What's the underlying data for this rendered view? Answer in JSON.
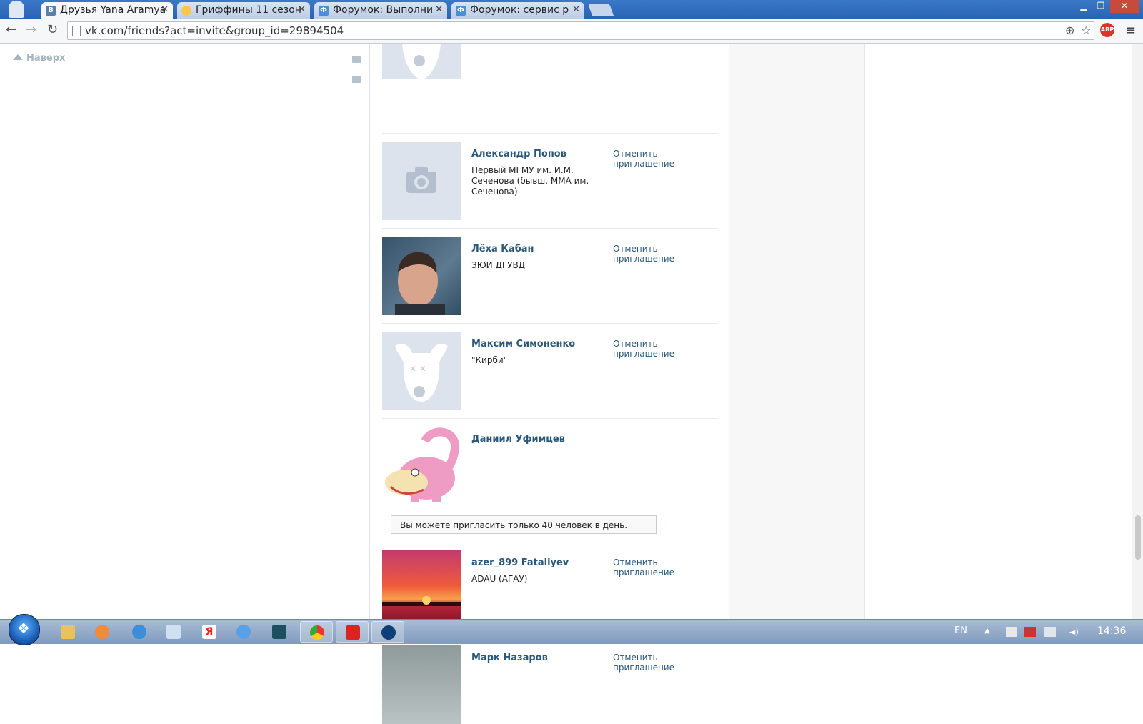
{
  "browser": {
    "tabs": [
      {
        "title": "Друзья Yana Aramya",
        "icon": "vk-icon",
        "active": true
      },
      {
        "title": "Гриффины 11 сезон",
        "icon": "multiplex-icon",
        "active": false
      },
      {
        "title": "Форумок: Выполни",
        "icon": "forum-icon",
        "active": false
      },
      {
        "title": "Форумок: сервис р",
        "icon": "forum-icon",
        "active": false
      }
    ],
    "url": "vk.com/friends?act=invite&group_id=29894504",
    "abp_label": "ABP"
  },
  "page": {
    "top_link": "Наверх",
    "invites": [
      {
        "name": "",
        "description": "",
        "cancel_label": "",
        "avatar": "dog-placeholder"
      },
      {
        "name": "Александр Попов",
        "description": "Первый МГМУ им. И.М. Сеченова (бывш. ММА им. Сеченова)",
        "cancel_label": "Отменить приглашение",
        "avatar": "camera-placeholder"
      },
      {
        "name": "Лёха Кабан",
        "description": "ЗЮИ ДГУВД",
        "cancel_label": "Отменить приглашение",
        "avatar": "photo"
      },
      {
        "name": "Максим Симоненко",
        "description": "\"Кирби\"",
        "cancel_label": "Отменить приглашение",
        "avatar": "dog-placeholder"
      },
      {
        "name": "Даниил Уфимцев",
        "description": "",
        "cancel_label": "",
        "avatar": "slowpoke",
        "notice": "Вы можете пригласить только 40 человек в день."
      },
      {
        "name": "azer_899 Fataliyev",
        "description": "ADAU (АГАУ)",
        "cancel_label": "Отменить приглашение",
        "avatar": "sunset"
      },
      {
        "name": "Марк Назаров",
        "description": "",
        "cancel_label": "Отменить приглашение",
        "avatar": "photo"
      }
    ]
  },
  "taskbar": {
    "language": "EN",
    "clock": "14:36"
  },
  "colors": {
    "vk_link": "#2b587a",
    "accent_blue": "#2a63b3"
  }
}
